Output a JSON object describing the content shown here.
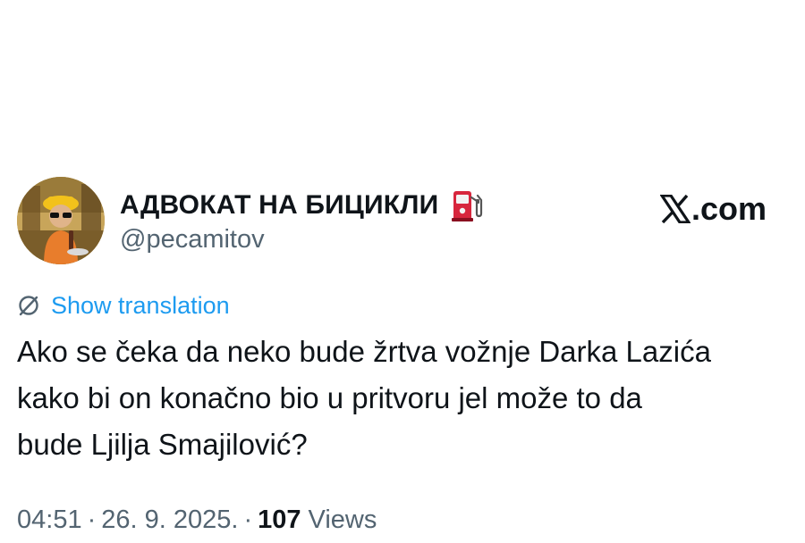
{
  "author": {
    "display_name": "АДВОКАТ НА БИЦИКЛИ",
    "handle": "@pecamitov",
    "name_emoji_icon": "fuel-pump-icon"
  },
  "brand": {
    "text": ".com",
    "logo_icon": "x-logo-icon"
  },
  "translation": {
    "label": "Show translation",
    "icon": "globe-icon",
    "color": "#1d9bf0"
  },
  "tweet": {
    "text": "Ako se čeka da neko bude žrtva vožnje Darka Lazića\nkako bi on konačno bio u pritvoru jel može to da\nbude Ljilja Smajilović?"
  },
  "meta": {
    "time": "04:51",
    "date": "26. 9. 2025.",
    "separator": "·",
    "views_count": "107",
    "views_label": "Views",
    "muted_color": "#536471"
  }
}
